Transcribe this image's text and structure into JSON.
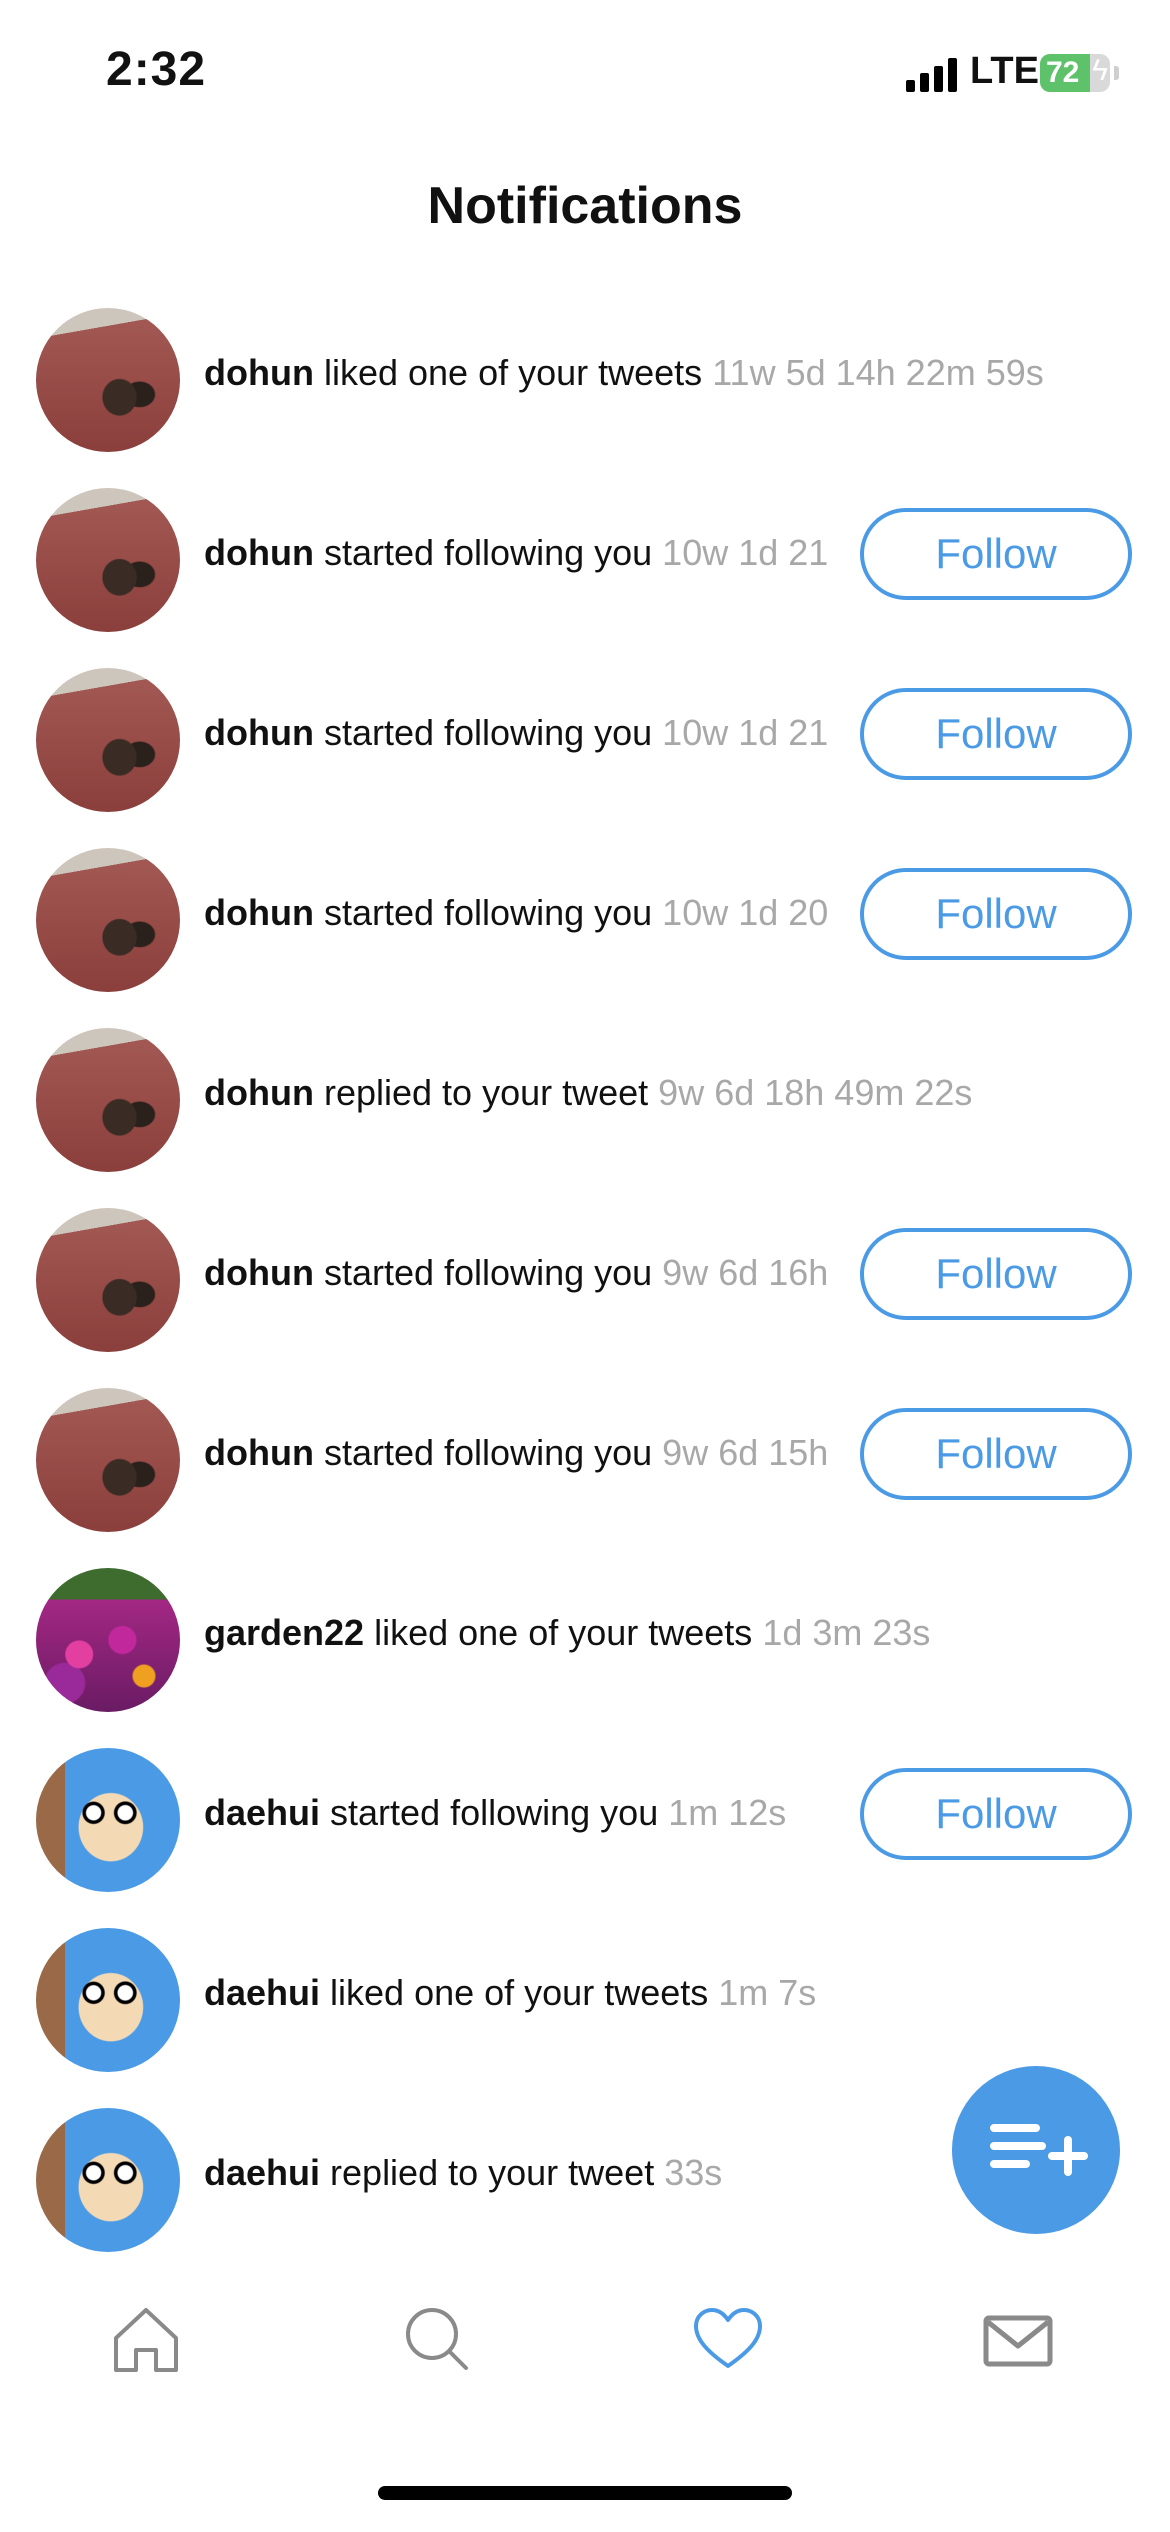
{
  "status_bar": {
    "time": "2:32",
    "network": "LTE",
    "battery": "72",
    "battery_level": 0.72
  },
  "header": {
    "title": "Notifications"
  },
  "notifications": [
    {
      "user": "dohun",
      "message": "liked one of your tweets",
      "time": "11w 5d 14h 22m 59s",
      "avatar": "cat-photo",
      "follow_button": null
    },
    {
      "user": "dohun",
      "message": "started following you",
      "time": "10w 1d 21",
      "avatar": "cat-photo",
      "follow_button": "Follow"
    },
    {
      "user": "dohun",
      "message": "started following you",
      "time": "10w 1d 21",
      "avatar": "cat-photo",
      "follow_button": "Follow"
    },
    {
      "user": "dohun",
      "message": "started following you",
      "time": "10w 1d 20",
      "avatar": "cat-photo",
      "follow_button": "Follow"
    },
    {
      "user": "dohun",
      "message": "replied to your tweet",
      "time": "9w 6d 18h 49m 22s",
      "avatar": "cat-photo",
      "follow_button": null
    },
    {
      "user": "dohun",
      "message": "started following you",
      "time": "9w 6d 16h",
      "avatar": "cat-photo",
      "follow_button": "Follow"
    },
    {
      "user": "dohun",
      "message": "started following you",
      "time": "9w 6d 15h",
      "avatar": "cat-photo",
      "follow_button": "Follow"
    },
    {
      "user": "garden22",
      "message": "liked one of your tweets",
      "time": "1d 3m 23s",
      "avatar": "flower-photo",
      "follow_button": null
    },
    {
      "user": "daehui",
      "message": "started following you",
      "time": "1m 12s",
      "avatar": "cartoon-photo",
      "follow_button": "Follow"
    },
    {
      "user": "daehui",
      "message": "liked one of your tweets",
      "time": "1m 7s",
      "avatar": "cartoon-photo",
      "follow_button": null
    },
    {
      "user": "daehui",
      "message": "replied to your tweet",
      "time": "33s",
      "avatar": "cartoon-photo",
      "follow_button": null
    }
  ],
  "fab": {
    "icon": "compose-tweet-icon"
  },
  "tab_bar": {
    "tabs": [
      {
        "icon": "home-icon",
        "active": false
      },
      {
        "icon": "search-icon",
        "active": false
      },
      {
        "icon": "heart-icon",
        "active": true
      },
      {
        "icon": "mail-icon",
        "active": false
      }
    ]
  },
  "colors": {
    "accent": "#4a9ae6",
    "timestamp": "#a8a8a8",
    "battery": "#5ec26a"
  }
}
